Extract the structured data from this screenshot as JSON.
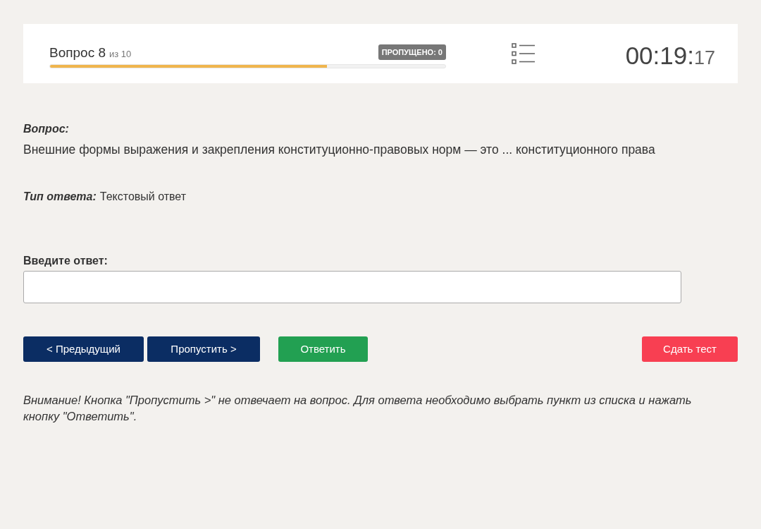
{
  "header": {
    "question_label": "Вопрос 8",
    "question_total": "из 10",
    "skipped_badge": "ПРОПУЩЕНО: 0",
    "progress": {
      "level": 0.7
    },
    "timer": {
      "main": "00:19:",
      "seconds": "17"
    }
  },
  "question": {
    "label": "Вопрос:",
    "text": "Внешние формы выражения и закрепления конституционно-правовых норм — это ... конституционного права"
  },
  "answer_type": {
    "label": "Тип ответа:",
    "value": "Текстовый ответ"
  },
  "answer_field": {
    "label": "Введите ответ:"
  },
  "buttons": [
    {
      "kind": "nav",
      "label": "< Предыдущий"
    },
    {
      "kind": "nav",
      "label": "Пропустить >"
    },
    {
      "kind": "answer",
      "label": "Ответить"
    },
    {
      "kind": "submit",
      "label": "Сдать тест"
    }
  ],
  "notice": "Внимание! Кнопка \"Пропустить >\" не отвечает на вопрос. Для ответа необходимо выбрать пункт из списка и нажать кнопку \"Ответить\"."
}
